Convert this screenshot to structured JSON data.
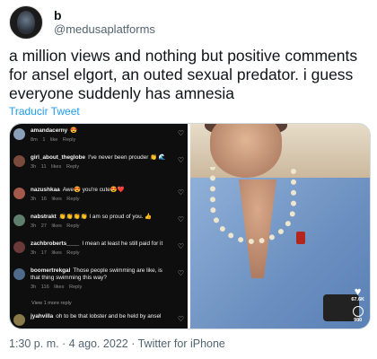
{
  "tweet": {
    "display_name": "b",
    "handle": "@medusaplatforms",
    "text": "a million views and nothing but positive comments for ansel elgort, an outed sexual predator. i guess everyone suddenly has amnesia",
    "translate_label": "Traducir Tweet",
    "timestamp": "1:30 p. m. · 4 ago. 2022 · Twitter for iPhone"
  },
  "comments": [
    {
      "user": "amandacerny",
      "text": "😍",
      "meta": "8m 1 like Reply",
      "avatar_color": "#8aa0b8"
    },
    {
      "user": "girl_about_theglobe",
      "text": "I've never been prouder 👏 🌊",
      "meta": "3h 11 likes Reply",
      "avatar_color": "#7a4a3c"
    },
    {
      "user": "nazushkaa",
      "text": "Awe😍 you're cute😍❤️",
      "meta": "3h 16 likes Reply",
      "avatar_color": "#a45a4a"
    },
    {
      "user": "nabstrakt",
      "text": "👏👏👏👏 I am so proud of you. 👍",
      "meta": "3h 27 likes Reply",
      "avatar_color": "#5f7f6e"
    },
    {
      "user": "zachbroberts____",
      "text": "I mean at least he still paid for it",
      "meta": "3h 17 likes Reply",
      "avatar_color": "#6a3a3a"
    },
    {
      "user": "boomertrekgal",
      "text": "Those people swimming are like, is that thing swimming this way?",
      "meta": "3h 116 likes Reply",
      "avatar_color": "#4f6a8a"
    },
    {
      "user": "jyahvilla",
      "text": "oh to be that lobster and be held by ansel",
      "meta": "",
      "avatar_color": "#8a7a4a"
    }
  ],
  "view_replies_label": "View 1 more reply",
  "reel_overlay": {
    "likes": "67.6K",
    "comments": "980"
  }
}
